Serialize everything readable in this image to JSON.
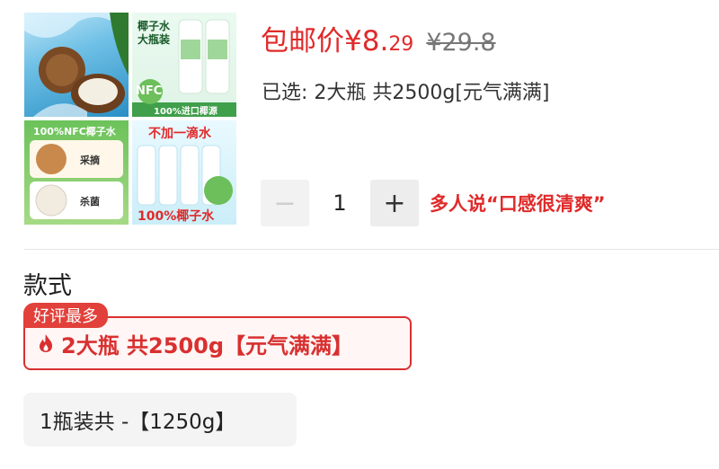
{
  "product_image": {
    "q2_title": "椰子水\n大瓶装",
    "q2_badge": "NFC",
    "q2_strip": "100%进口椰源",
    "q3_title": "100%NFC椰子水",
    "q3_label1": "采摘",
    "q3_label2": "杀菌",
    "q4_title": "不加一滴水",
    "q4_footer": "100%椰子水"
  },
  "price": {
    "label": "包邮价",
    "main": "¥8.",
    "decimal": "29",
    "original": "¥29.8"
  },
  "selection": {
    "text": "已选: 2大瓶 共2500g[元气满满]"
  },
  "stepper": {
    "minus": "−",
    "quantity": "1",
    "plus": "+"
  },
  "hint": "多人说“口感很清爽”",
  "section": {
    "title": "款式"
  },
  "options": {
    "selected_badge": "好评最多",
    "selected_label": "2大瓶 共2500g【元气满满】",
    "other_label": "1瓶装共 -【1250g】"
  },
  "colors": {
    "accent": "#e02a2a",
    "selected_border": "#d93030",
    "option_bg": "#f4f4f4"
  }
}
